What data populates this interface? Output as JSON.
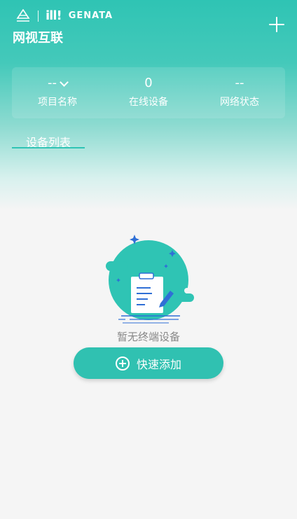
{
  "header": {
    "logo_text": "GENATA",
    "logo_bars": "ill!",
    "title": "网视互联"
  },
  "stats": [
    {
      "value": "--",
      "label": "项目名称"
    },
    {
      "value": "0",
      "label": "在线设备"
    },
    {
      "value": "--",
      "label": "网络状态"
    }
  ],
  "tabs": [
    {
      "label": "设备列表"
    }
  ],
  "empty": {
    "message": "暂无终端设备"
  },
  "actions": {
    "quick_add_label": "快速添加"
  },
  "colors": {
    "accent": "#2fc4b4",
    "button": "#30c1b1",
    "background": "#f5f5f5"
  },
  "icons": {
    "top_add": "plus-icon",
    "dropdown": "chevron-down-icon",
    "quick_add": "plus-circle-icon"
  }
}
